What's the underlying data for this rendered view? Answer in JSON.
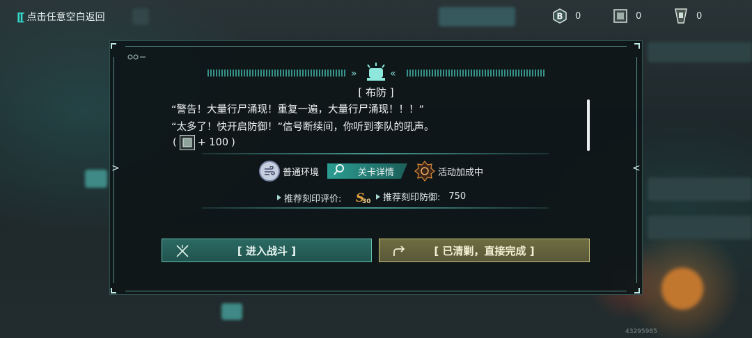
{
  "back": {
    "label": "点击任意空白返回"
  },
  "resources": [
    {
      "icon": "b-coin-icon",
      "value": "0"
    },
    {
      "icon": "supply-box-icon",
      "value": "0"
    },
    {
      "icon": "ticket-icon",
      "value": "0"
    }
  ],
  "dialog": {
    "title": "[ 布防 ]",
    "lines": [
      "“警告！大量行尸涌现！重复一遍，大量行尸涌现！！！”",
      "“太多了！快开启防御！”信号断续间，你听到李队的吼声。"
    ],
    "reward": {
      "open": "(",
      "amount": "+ 100",
      "close": ")"
    },
    "tags": {
      "environment": "普通环境",
      "level_detail": "关卡详情",
      "event": "活动加成中"
    },
    "recommend": {
      "rating_label": "推荐刻印评价:",
      "rating_badge": "30",
      "defense_label": "推荐刻印防御:",
      "defense_value": "750"
    },
    "buttons": {
      "fight": "[ 进入战斗 ]",
      "complete": "[ 已清剿，直接完成 ]"
    }
  },
  "footer_id": "43295985",
  "colors": {
    "accent": "#33d7c6",
    "fight": "#2b6a63",
    "complete": "#6f6d40"
  }
}
